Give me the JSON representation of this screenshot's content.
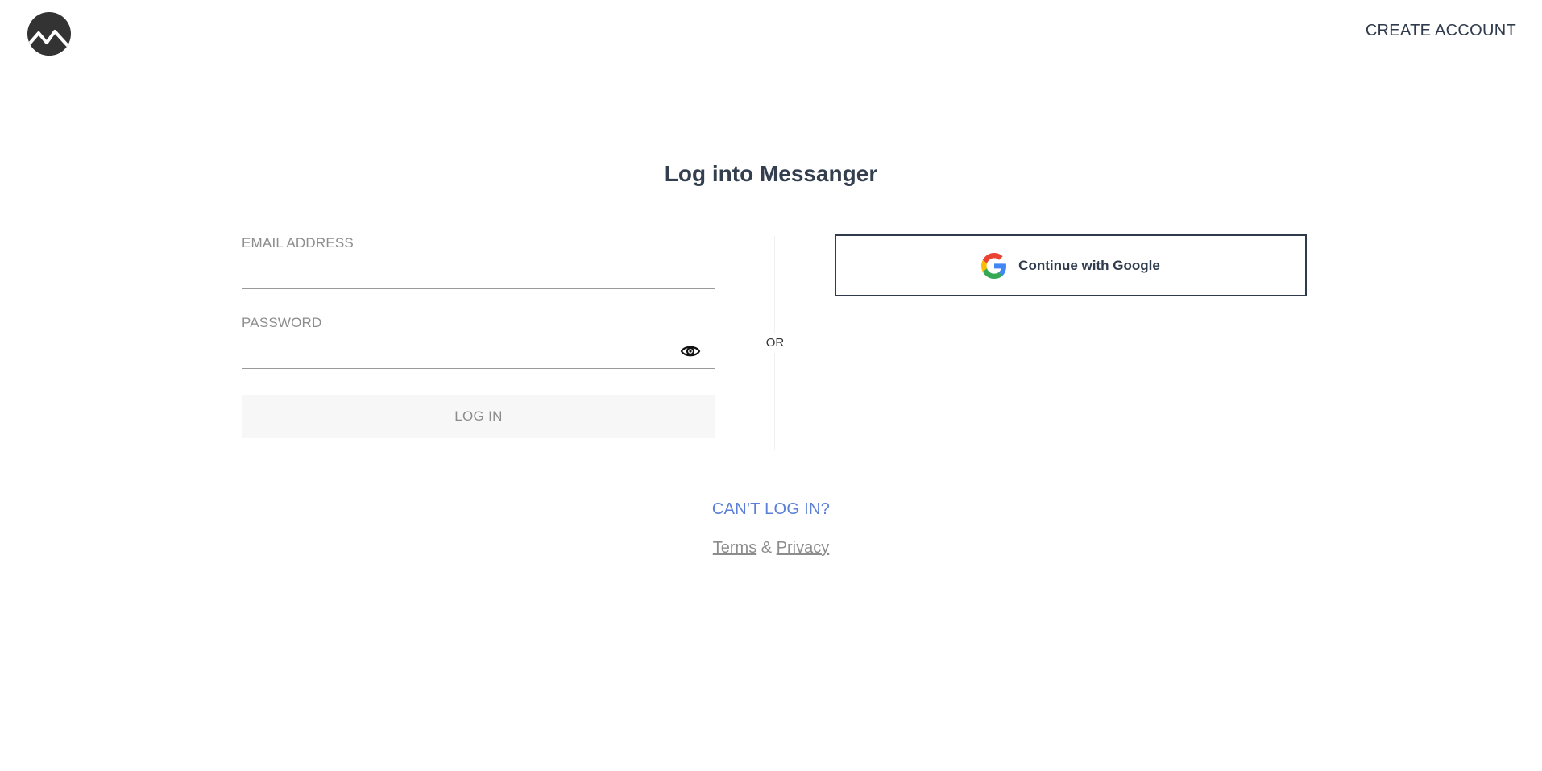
{
  "header": {
    "logo_icon": "mountain-logo-icon",
    "create_account_label": "CREATE ACCOUNT"
  },
  "title": "Log into Messanger",
  "form": {
    "email_label": "EMAIL ADDRESS",
    "email_value": "",
    "password_label": "PASSWORD",
    "password_value": "",
    "password_toggle_icon": "eye-icon",
    "login_label": "LOG IN"
  },
  "divider_label": "OR",
  "social": {
    "google_label": "Continue with Google",
    "google_icon": "google-g-icon"
  },
  "footer": {
    "cant_login_label": "CAN'T LOG IN?",
    "terms_label": "Terms",
    "ampersand": "&",
    "privacy_label": "Privacy"
  },
  "colors": {
    "text_dark": "#2f3b4c",
    "link_blue": "#5b7fd6",
    "muted": "#8c8c8c",
    "button_bg": "#f7f7f7"
  }
}
